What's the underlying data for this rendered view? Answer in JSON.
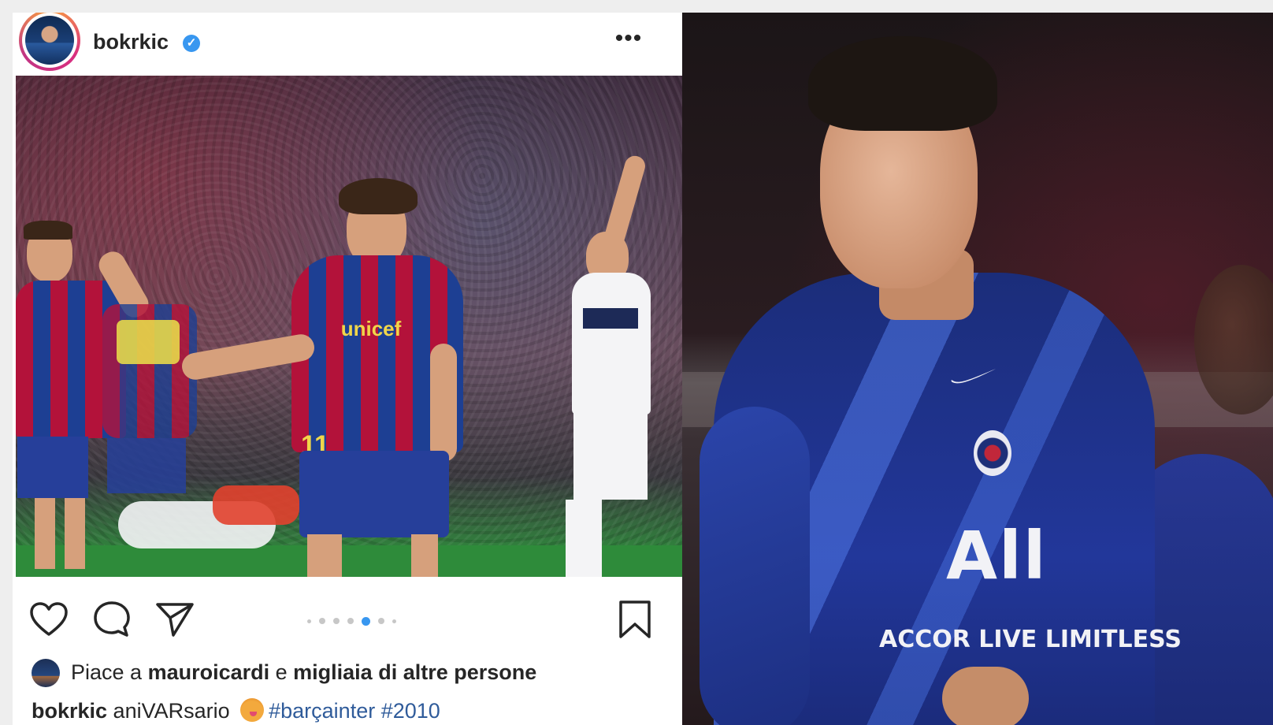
{
  "post": {
    "username": "bokrkic",
    "verified_mark": "✓",
    "more_label": "•••",
    "likes": {
      "prefix": "Piace a ",
      "liker": "mauroicardi",
      "connector": " e ",
      "rest": "migliaia di altre persone"
    },
    "caption": {
      "user": "bokrkic",
      "text": " aniVARsario ",
      "hashtags": "#barçainter #2010"
    },
    "carousel": {
      "total_dots": 7,
      "active_index": 3
    }
  },
  "right_photo": {
    "sponsor_main": "All",
    "sponsor_sub": "ACCOR LIVE LIMITLESS"
  },
  "left_photo": {
    "shirt_sponsor": "unicef",
    "shirt_number": "11"
  },
  "colors": {
    "verified_blue": "#3897f0",
    "hashtag_blue": "#2f5b9a",
    "text_dark": "#262626"
  },
  "icons": {
    "like": "heart-icon",
    "comment": "comment-icon",
    "share": "send-icon",
    "save": "bookmark-icon",
    "more": "more-icon",
    "verified": "verified-icon"
  }
}
